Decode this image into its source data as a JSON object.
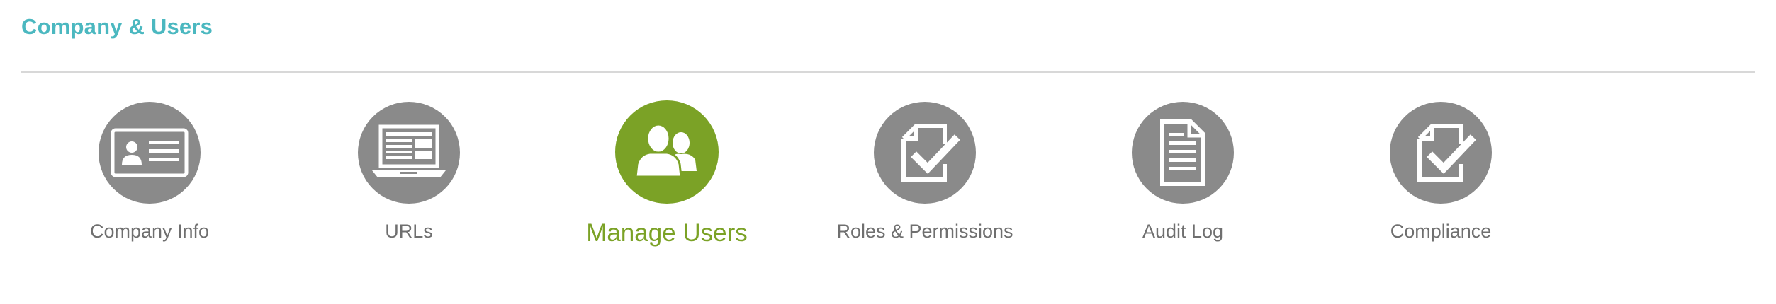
{
  "header": {
    "title": "Company & Users"
  },
  "colors": {
    "title": "#4bb8c0",
    "icon_circle": "#8a8a8a",
    "active": "#7ba226",
    "label": "#6f6f6f"
  },
  "nav": {
    "items": [
      {
        "label": "Company Info",
        "icon": "id-card-icon",
        "active": false
      },
      {
        "label": "URLs",
        "icon": "laptop-icon",
        "active": false
      },
      {
        "label": "Manage Users",
        "icon": "users-icon",
        "active": true
      },
      {
        "label": "Roles & Permissions",
        "icon": "document-check-icon",
        "active": false
      },
      {
        "label": "Audit Log",
        "icon": "document-icon",
        "active": false
      },
      {
        "label": "Compliance",
        "icon": "document-check-icon",
        "active": false
      }
    ]
  }
}
